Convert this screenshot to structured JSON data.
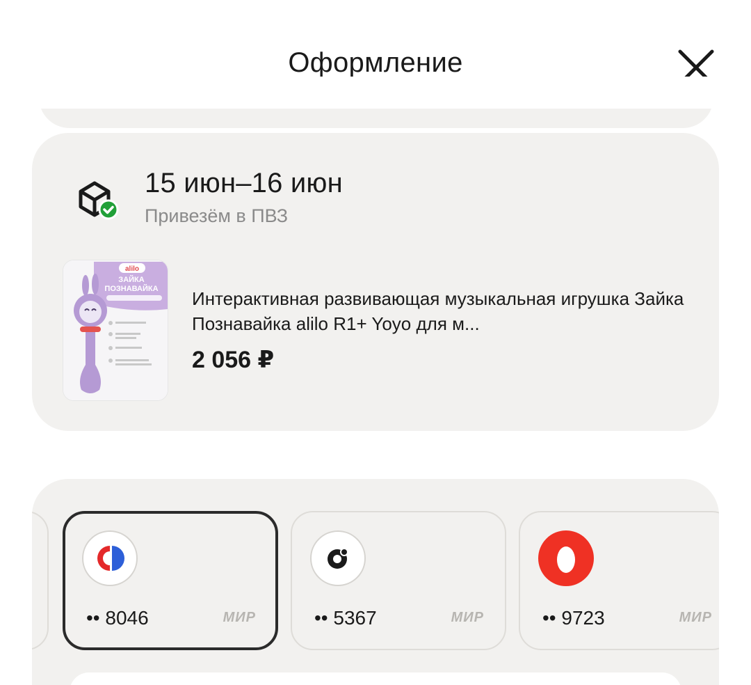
{
  "header": {
    "title": "Оформление",
    "close_icon": "close-icon"
  },
  "delivery": {
    "icon": "box-check-icon",
    "dates": "15 июн–16 июн",
    "subtitle": "Привезём в ПВЗ",
    "product": {
      "image_brand": "alilo",
      "image_title_1": "ЗАЙКА",
      "image_title_2": "ПОЗНАВАЙКА",
      "name": "Интерактивная развивающая музыкальная игрушка Зайка Познавайка alilo R1+ Yoyo для м...",
      "price": "2 056 ₽"
    }
  },
  "payment": {
    "cards": [
      {
        "number": "•• 8046",
        "system": "МИР",
        "bank_icon": "bank-logo-mts-icon",
        "selected": true
      },
      {
        "number": "•• 5367",
        "system": "МИР",
        "bank_icon": "bank-logo-ozon-icon",
        "selected": false
      },
      {
        "number": "•• 9723",
        "system": "МИР",
        "bank_icon": "bank-logo-alfa-icon",
        "selected": false
      }
    ]
  },
  "colors": {
    "card_bg": "#f2f1ef",
    "accent_green": "#21a038",
    "alfa_red": "#ef3124",
    "selected_border": "#2b2b2b"
  }
}
